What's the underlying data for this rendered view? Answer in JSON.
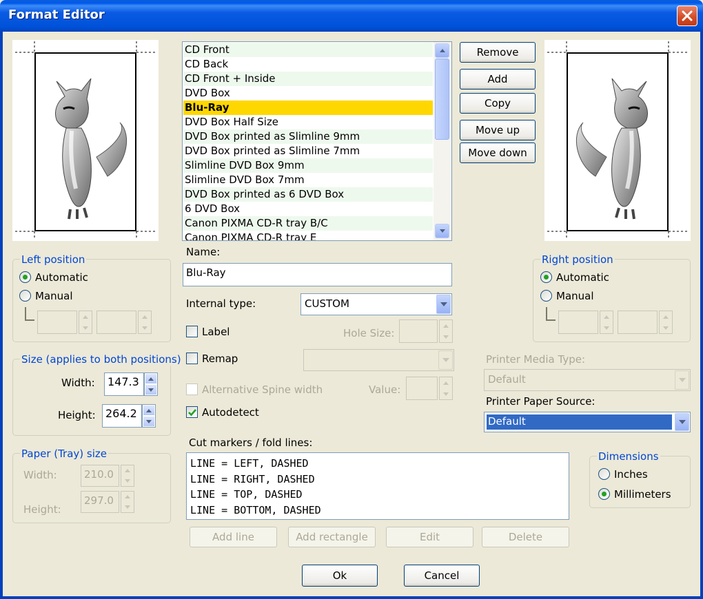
{
  "window": {
    "title": "Format Editor"
  },
  "formats": {
    "items": [
      "CD Front",
      "CD Back",
      "CD Front + Inside",
      "DVD Box",
      "Blu-Ray",
      "DVD Box Half Size",
      "DVD Box printed as Slimline 9mm",
      "DVD Box printed as Slimline 7mm",
      "Slimline DVD Box 9mm",
      "Slimline DVD Box 7mm",
      "DVD Box printed as 6 DVD Box",
      "6 DVD Box",
      "Canon PIXMA CD-R tray B/C",
      "Canon PIXMA CD-R tray E"
    ],
    "selected_index": 4
  },
  "list_buttons": {
    "remove": "Remove",
    "add": "Add",
    "copy": "Copy",
    "move_up": "Move up",
    "move_down": "Move down"
  },
  "left_position": {
    "legend": "Left position",
    "automatic": "Automatic",
    "manual": "Manual",
    "selected": "automatic"
  },
  "right_position": {
    "legend": "Right position",
    "automatic": "Automatic",
    "manual": "Manual",
    "selected": "automatic"
  },
  "size": {
    "legend": "Size (applies to both positions)",
    "width_label": "Width:",
    "width_value": "147.3",
    "height_label": "Height:",
    "height_value": "264.2"
  },
  "paper": {
    "legend": "Paper (Tray) size",
    "width_label": "Width:",
    "width_value": "210.0",
    "height_label": "Height:",
    "height_value": "297.0"
  },
  "name": {
    "label": "Name:",
    "value": "Blu-Ray"
  },
  "internal_type": {
    "label": "Internal type:",
    "value": "CUSTOM"
  },
  "options": {
    "label": {
      "text": "Label",
      "checked": false
    },
    "hole_size_label": "Hole Size:",
    "remap": {
      "text": "Remap",
      "checked": false
    },
    "alt_spine": {
      "text": "Alternative Spine width",
      "checked": false
    },
    "value_label": "Value:",
    "autodetect": {
      "text": "Autodetect",
      "checked": true
    }
  },
  "printer": {
    "media_type_label": "Printer Media Type:",
    "media_type_value": "Default",
    "paper_source_label": "Printer Paper Source:",
    "paper_source_value": "Default"
  },
  "cut_markers": {
    "label": "Cut markers / fold lines:",
    "lines": [
      "LINE = LEFT, DASHED",
      "LINE = RIGHT, DASHED",
      "LINE = TOP, DASHED",
      "LINE = BOTTOM, DASHED"
    ]
  },
  "cut_buttons": {
    "add_line": "Add line",
    "add_rectangle": "Add rectangle",
    "edit": "Edit",
    "delete": "Delete"
  },
  "dimensions": {
    "legend": "Dimensions",
    "inches": "Inches",
    "millimeters": "Millimeters",
    "selected": "millimeters"
  },
  "footer": {
    "ok": "Ok",
    "cancel": "Cancel"
  },
  "colors": {
    "title_bar": "#0054e3",
    "dialog_bg": "#ece9d8",
    "selection": "#ffd700",
    "list_alt_row": "#eef9ee",
    "legend_text": "#0046d5",
    "focus_select": "#316ac5"
  }
}
